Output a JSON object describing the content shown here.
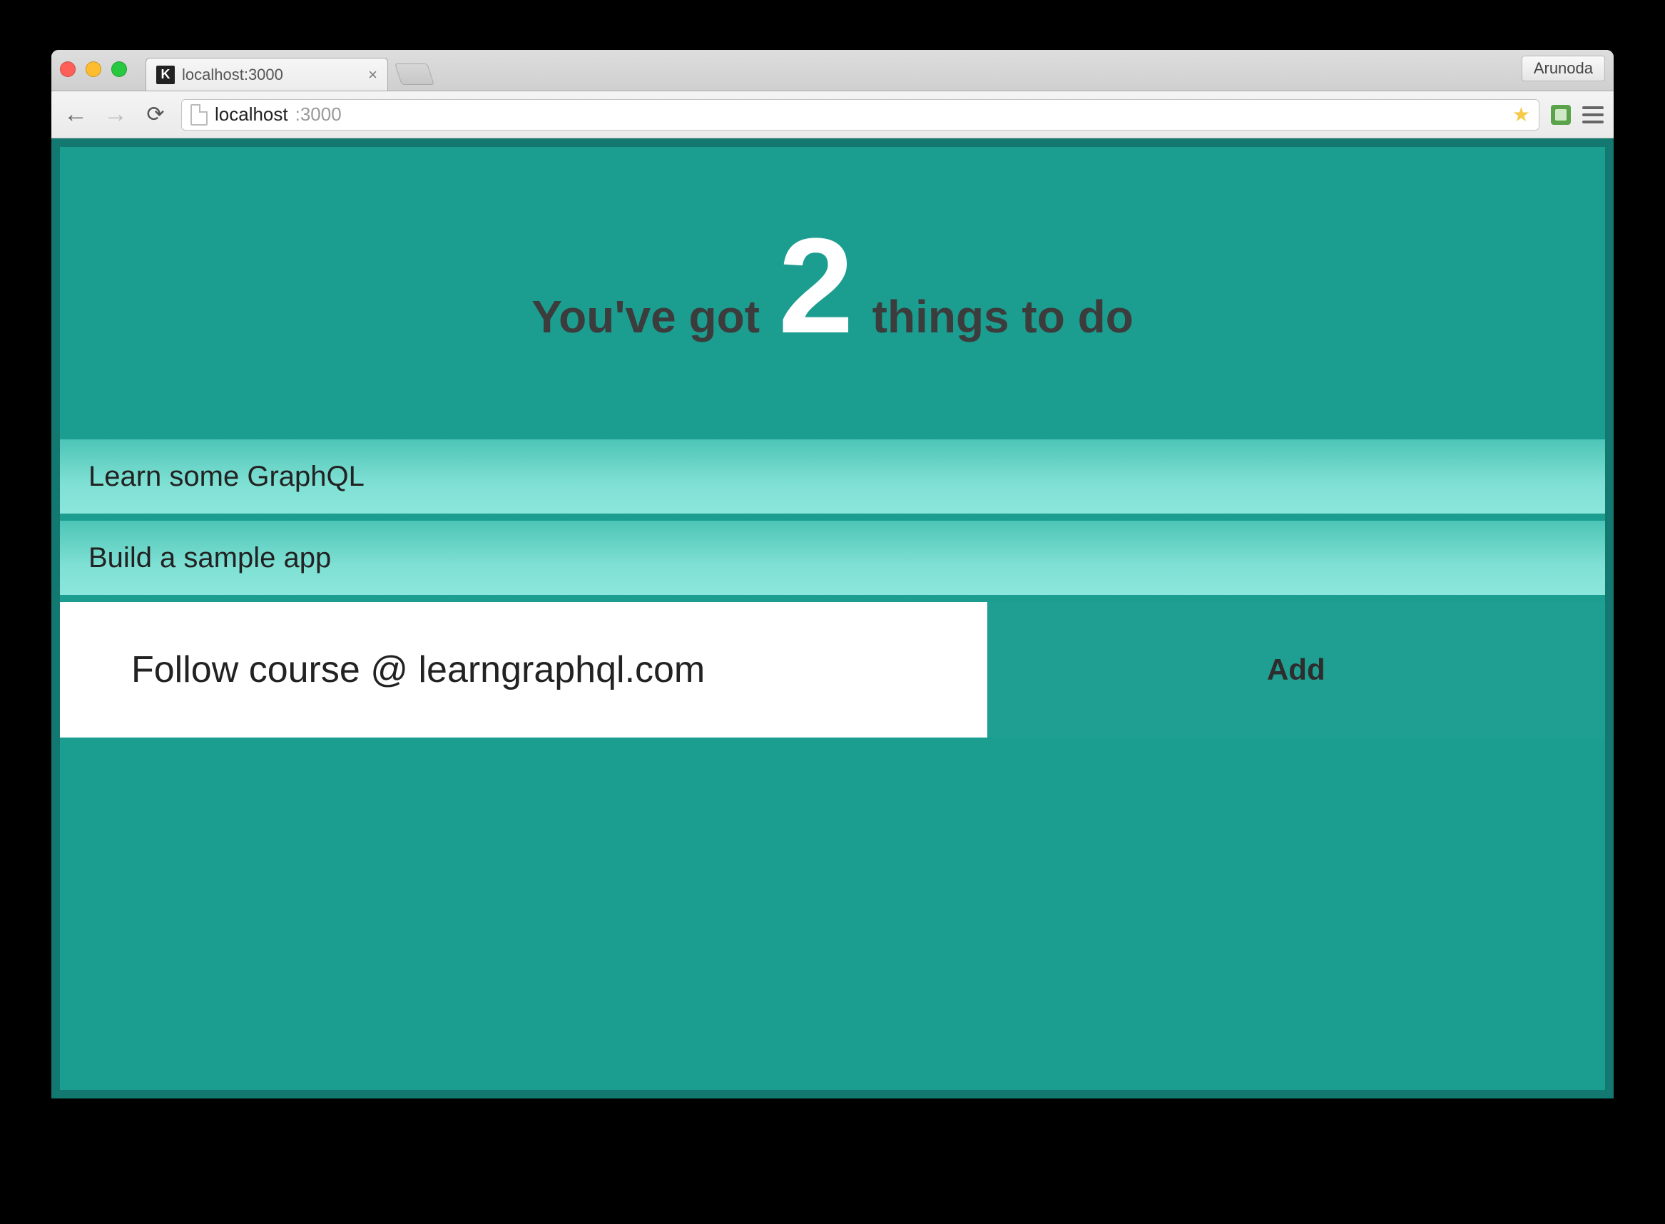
{
  "browser": {
    "tab_title": "localhost:3000",
    "favicon_letter": "K",
    "profile_label": "Arunoda",
    "url_host": "localhost",
    "url_port": ":3000"
  },
  "header": {
    "lead": "You've got",
    "count": "2",
    "trail": "things to do"
  },
  "todos": [
    {
      "text": "Learn some GraphQL"
    },
    {
      "text": "Build a sample app"
    }
  ],
  "add": {
    "input_value": "Follow course @ learngraphql.com",
    "button_label": "Add"
  }
}
